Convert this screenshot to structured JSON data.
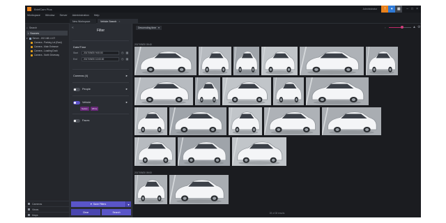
{
  "app": {
    "title": "BriefCam Plus",
    "user": "Administrator"
  },
  "menu": [
    "Workspace",
    "Window",
    "Server",
    "Administration",
    "Help"
  ],
  "tabs": [
    {
      "label": "New Workspace"
    },
    {
      "label": "Vehicle Search"
    }
  ],
  "sidebar": {
    "search_label": "Search",
    "sources_label": "Sources",
    "tree": [
      {
        "label": "Server - 192.168.1.107"
      },
      {
        "label": "Camera - Parking Lot (East)"
      },
      {
        "label": "Camera - Main Entrance"
      },
      {
        "label": "Camera - Loading Dock"
      },
      {
        "label": "Camera - North Driveway"
      }
    ],
    "bottom": [
      "Cameras",
      "Views",
      "Maps"
    ]
  },
  "filter": {
    "title": "Filter",
    "date_time_label": "Date/Time",
    "start_label": "Start",
    "start_value": "2017/09/20 9:00:00",
    "end_label": "End",
    "end_value": "2017/09/20 10:00:00",
    "cameras_label": "Cameras (4)",
    "people_label": "People",
    "people_toggle": false,
    "vehicle_label": "Vehicle",
    "vehicle_toggle": true,
    "vehicle_chips": [
      "Sedan",
      "White"
    ],
    "faces_label": "Faces",
    "faces_toggle": false,
    "save_label": "Save Filters",
    "clear_label": "Clear",
    "search_label": "Search"
  },
  "results": {
    "sort_label": "Descending time",
    "groups": [
      "2017/09/20 09:40",
      "2017/09/20 09:00"
    ],
    "footer": "28 of 28 results",
    "zoom_level": 0.6
  },
  "colors": {
    "accent": "#5a55c8",
    "warning": "#e8811c",
    "chip": "#6a2a7a"
  }
}
